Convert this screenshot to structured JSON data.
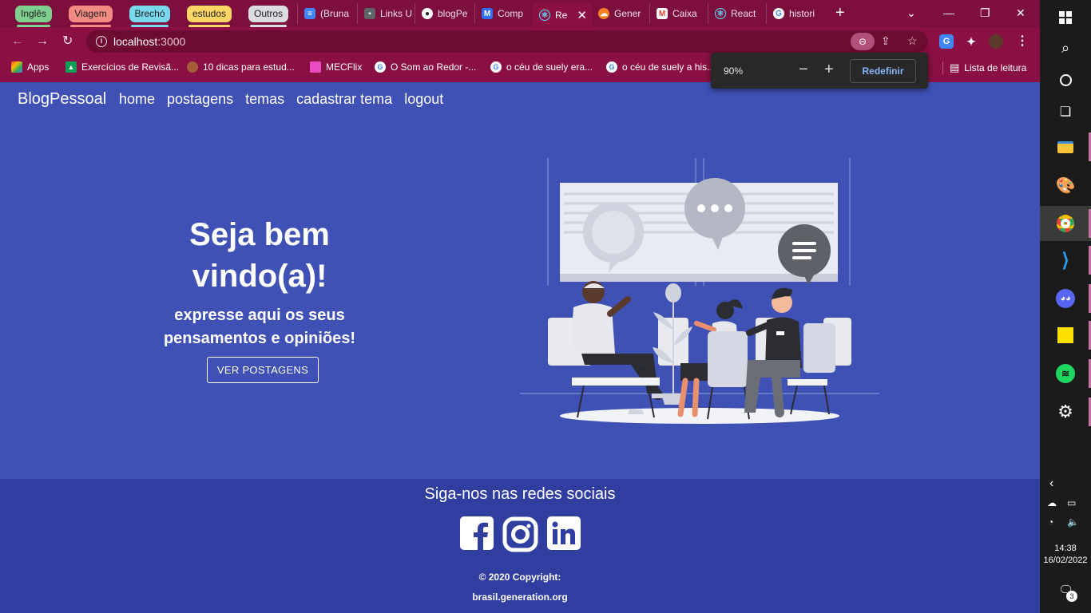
{
  "browser": {
    "tab_groups": [
      {
        "label": "Inglês",
        "color": "#7fcf8e"
      },
      {
        "label": "Viagem",
        "color": "#f28b82"
      },
      {
        "label": "Brechó",
        "color": "#78d9ec"
      },
      {
        "label": "estudos",
        "color": "#fdd663"
      },
      {
        "label": "Outros",
        "color": "#dadce0"
      }
    ],
    "tabs": [
      {
        "label": "(Bruna",
        "icon": "docs-icon",
        "color": "#4285f4"
      },
      {
        "label": "Links U",
        "icon": "save-icon",
        "color": "#5f6368"
      },
      {
        "label": "blogPe",
        "icon": "github-icon",
        "color": "#24292e"
      },
      {
        "label": "Comp",
        "icon": "compose-icon",
        "color": "#2d6ff0"
      },
      {
        "label": "Re",
        "icon": "react-icon",
        "color": "#0b5c5c",
        "active": true
      },
      {
        "label": "Gener",
        "icon": "cloud-icon",
        "color": "#f48120"
      },
      {
        "label": "Caixa",
        "icon": "gmail-icon",
        "color": "#ea4335"
      },
      {
        "label": "React",
        "icon": "react-icon",
        "color": "#0b5c5c"
      },
      {
        "label": "histori",
        "icon": "google-icon",
        "color": "#ffffff"
      }
    ],
    "address": {
      "host": "localhost",
      "port": ":3000"
    },
    "bookmarks": [
      {
        "label": "Apps",
        "icon": "apps-grid-icon",
        "color": "#f9ab00"
      },
      {
        "label": "Exercícios de Revisã...",
        "icon": "drive-icon",
        "color": "#0f9d58"
      },
      {
        "label": "10 dicas para estud...",
        "icon": "avatar-icon",
        "color": "#a65c3a"
      },
      {
        "label": "MECFlix",
        "icon": "mecflix-icon",
        "color": "#e94cc1"
      },
      {
        "label": "O Som ao Redor -...",
        "icon": "google-icon",
        "color": "#ffffff"
      },
      {
        "label": "o céu de suely era...",
        "icon": "google-icon",
        "color": "#ffffff"
      },
      {
        "label": "o céu de suely a his...",
        "icon": "google-icon",
        "color": "#ffffff"
      }
    ],
    "reading_list": "Lista de leitura",
    "zoom_popup": {
      "value": "90%",
      "minus": "−",
      "plus": "+",
      "reset": "Redefinir"
    }
  },
  "page": {
    "brand": "BlogPessoal",
    "nav": [
      "home",
      "postagens",
      "temas",
      "cadastrar tema",
      "logout"
    ],
    "hero": {
      "title": "Seja bem vindo(a)!",
      "subtitle": "expresse aqui os seus pensamentos e opiniões!",
      "button": "VER POSTAGENS"
    },
    "footer": {
      "follow": "Siga-nos nas redes sociais",
      "socials": [
        "facebook-icon",
        "instagram-icon",
        "linkedin-icon"
      ],
      "copyright": "© 2020 Copyright:",
      "site": "brasil.generation.org"
    },
    "colors": {
      "primary": "#3f51b5",
      "footer": "#303f9f",
      "chrome": "#8a1043"
    }
  },
  "taskbar": {
    "time": "14:38",
    "date": "16/02/2022",
    "notifications": "3",
    "apps": [
      "windows-start-icon",
      "search-icon",
      "cortana-icon",
      "task-view-icon",
      "file-explorer-icon",
      "paint-icon",
      "chrome-icon",
      "vscode-icon",
      "discord-icon",
      "sticky-notes-icon",
      "spotify-icon",
      "settings-icon"
    ]
  }
}
